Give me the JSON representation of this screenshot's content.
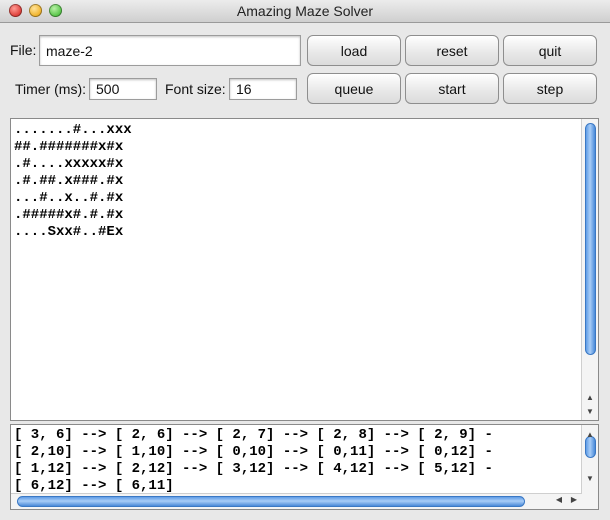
{
  "window": {
    "title": "Amazing Maze Solver"
  },
  "controls": {
    "file_label": "File:",
    "file_value": "maze-2",
    "timer_label": "Timer (ms):",
    "timer_value": "500",
    "fontsize_label": "Font size:",
    "fontsize_value": "16"
  },
  "buttons": {
    "load": "load",
    "reset": "reset",
    "quit": "quit",
    "queue": "queue",
    "start": "start",
    "step": "step"
  },
  "maze": {
    "lines": [
      ".......#...xxx",
      "##.#######x#x",
      ".#....xxxxx#x",
      ".#.##.x###.#x",
      "...#..x..#.#x",
      ".#####x#.#.#x",
      "....Sxx#..#Ex"
    ]
  },
  "path": {
    "lines": [
      "[ 3, 6] --> [ 2, 6] --> [ 2, 7] --> [ 2, 8] --> [ 2, 9] -",
      "[ 2,10] --> [ 1,10] --> [ 0,10] --> [ 0,11] --> [ 0,12] -",
      "[ 1,12] --> [ 2,12] --> [ 3,12] --> [ 4,12] --> [ 5,12] -",
      "[ 6,12] --> [ 6,11]"
    ]
  },
  "scrollbars": {
    "up_arrow": "▲",
    "down_arrow": "▼",
    "left_arrow": "◀",
    "right_arrow": "▶"
  }
}
